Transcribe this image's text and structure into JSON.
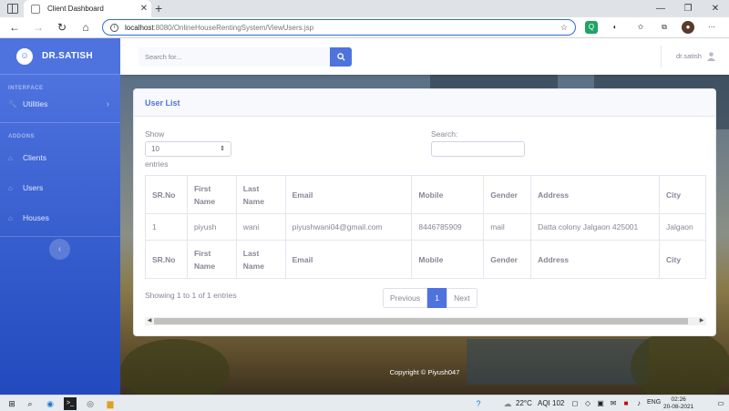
{
  "browser": {
    "tab_title": "Client Dashboard",
    "url_host": "localhost",
    "url_path": ":8080/OnlineHouseRentingSystem/ViewUsers.jsp"
  },
  "sidebar": {
    "brand": "DR.SATISH",
    "sections": [
      {
        "heading": "INTERFACE",
        "items": [
          {
            "label": "Utilities",
            "icon": "wrench-icon"
          }
        ]
      },
      {
        "heading": "ADDONS",
        "items": [
          {
            "label": "Clients",
            "icon": "home-icon"
          },
          {
            "label": "Users",
            "icon": "home-icon"
          },
          {
            "label": "Houses",
            "icon": "home-icon"
          }
        ]
      }
    ]
  },
  "topbar": {
    "search_placeholder": "Search for...",
    "user_name": "dr.satish"
  },
  "card": {
    "title": "User List",
    "show_label": "Show",
    "length_value": "10",
    "entries_label": "entries",
    "search_label": "Search:",
    "columns": [
      "SR.No",
      "First Name",
      "Last Name",
      "Email",
      "Mobile",
      "Gender",
      "Address",
      "City"
    ],
    "rows": [
      [
        "1",
        "piyush",
        "wani",
        "piyushwani04@gmail.com",
        "8446785909",
        "mail",
        "Datta colony Jalgaon 425001",
        "Jalgaon"
      ]
    ],
    "info": "Showing 1 to 1 of 1 entries",
    "pager": {
      "previous": "Previous",
      "current": "1",
      "next": "Next"
    }
  },
  "footer": "Copyright © Piyush047",
  "taskbar": {
    "weather": "22°C",
    "aqi": "AQI 102",
    "lang": "ENG",
    "time": "02:26",
    "date": "20-08-2021"
  },
  "colors": {
    "primary": "#4e73df",
    "sidebar_bottom": "#224abe",
    "text": "#858796"
  }
}
